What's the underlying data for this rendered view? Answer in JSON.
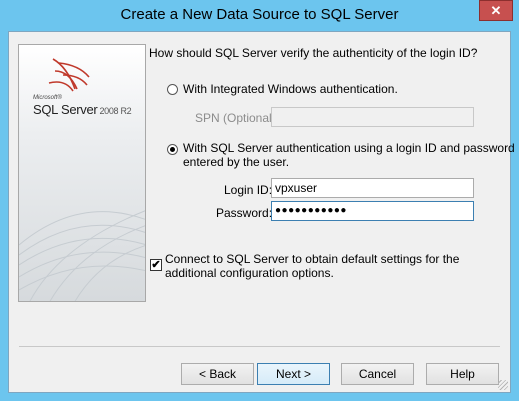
{
  "window": {
    "title": "Create a New Data Source to SQL Server",
    "close_glyph": "✕"
  },
  "branding": {
    "microsoft": "Microsoft®",
    "product": "SQL Server",
    "version": "2008 R2"
  },
  "question": "How should SQL Server verify the authenticity of the login ID?",
  "auth_options": {
    "windows_label": "With Integrated Windows authentication.",
    "windows_selected": false,
    "spn_label": "SPN (Optional):",
    "spn_value": "",
    "sql_label_line1": "With SQL Server authentication using a login ID and password",
    "sql_label_line2": "entered by the user.",
    "sql_selected": true
  },
  "login": {
    "label": "Login ID:",
    "value": "vpxuser"
  },
  "password": {
    "label": "Password:",
    "masked_value": "●●●●●●●●●●●"
  },
  "connect_option": {
    "label_line1": "Connect to SQL Server to obtain default settings for the",
    "label_line2": "additional configuration options.",
    "checked": true,
    "check_glyph": "✔"
  },
  "buttons": {
    "back": "< Back",
    "next": "Next >",
    "cancel": "Cancel",
    "help": "Help"
  },
  "colors": {
    "title_bar": "#6cc5ee",
    "close_button": "#c7504f",
    "dialog_bg": "#f0f0f0",
    "logo_red": "#c0392b"
  }
}
